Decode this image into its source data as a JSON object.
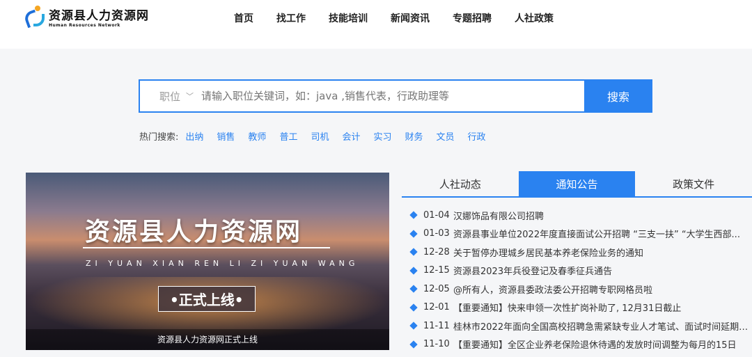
{
  "logo": {
    "title": "资源县人力资源网",
    "subtitle": "Human Resources Network"
  },
  "nav": [
    "首页",
    "找工作",
    "技能培训",
    "新闻资讯",
    "专题招聘",
    "人社政策"
  ],
  "search": {
    "select": "职位",
    "placeholder": "请输入职位关键词，如：java ,销售代表，行政助理等",
    "button": "搜索"
  },
  "hot": {
    "label": "热门搜索:",
    "items": [
      "出纳",
      "销售",
      "教师",
      "普工",
      "司机",
      "会计",
      "实习",
      "财务",
      "文员",
      "行政"
    ]
  },
  "banner": {
    "title": "资源县人力资源网",
    "pinyin": "ZI YUAN XIAN REN LI ZI YUAN WANG",
    "tag": "•正式上线•",
    "caption": "资源县人力资源网正式上线"
  },
  "tabs": [
    {
      "label": "人社动态",
      "active": false
    },
    {
      "label": "通知公告",
      "active": true
    },
    {
      "label": "政策文件",
      "active": false
    }
  ],
  "news": [
    {
      "date": "01-04",
      "title": "汉娜饰品有限公司招聘"
    },
    {
      "date": "01-03",
      "title": "资源县事业单位2022年度直接面试公开招聘 “三支一扶” “大学生西部..."
    },
    {
      "date": "12-28",
      "title": "关于暂停办理城乡居民基本养老保险业务的通知"
    },
    {
      "date": "12-15",
      "title": "资源县2023年兵役登记及春季征兵通告"
    },
    {
      "date": "12-05",
      "title": "@所有人，资源县委政法委公开招聘专职网格员啦"
    },
    {
      "date": "12-01",
      "title": "【重要通知】快来申领一次性扩岗补助了, 12月31日截止"
    },
    {
      "date": "11-11",
      "title": "桂林市2022年面向全国高校招聘急需紧缺专业人才笔试、面试时间延期公..."
    },
    {
      "date": "11-10",
      "title": "【重要通知】全区企业养老保险退休待遇的发放时间调整为每月的15日"
    }
  ]
}
